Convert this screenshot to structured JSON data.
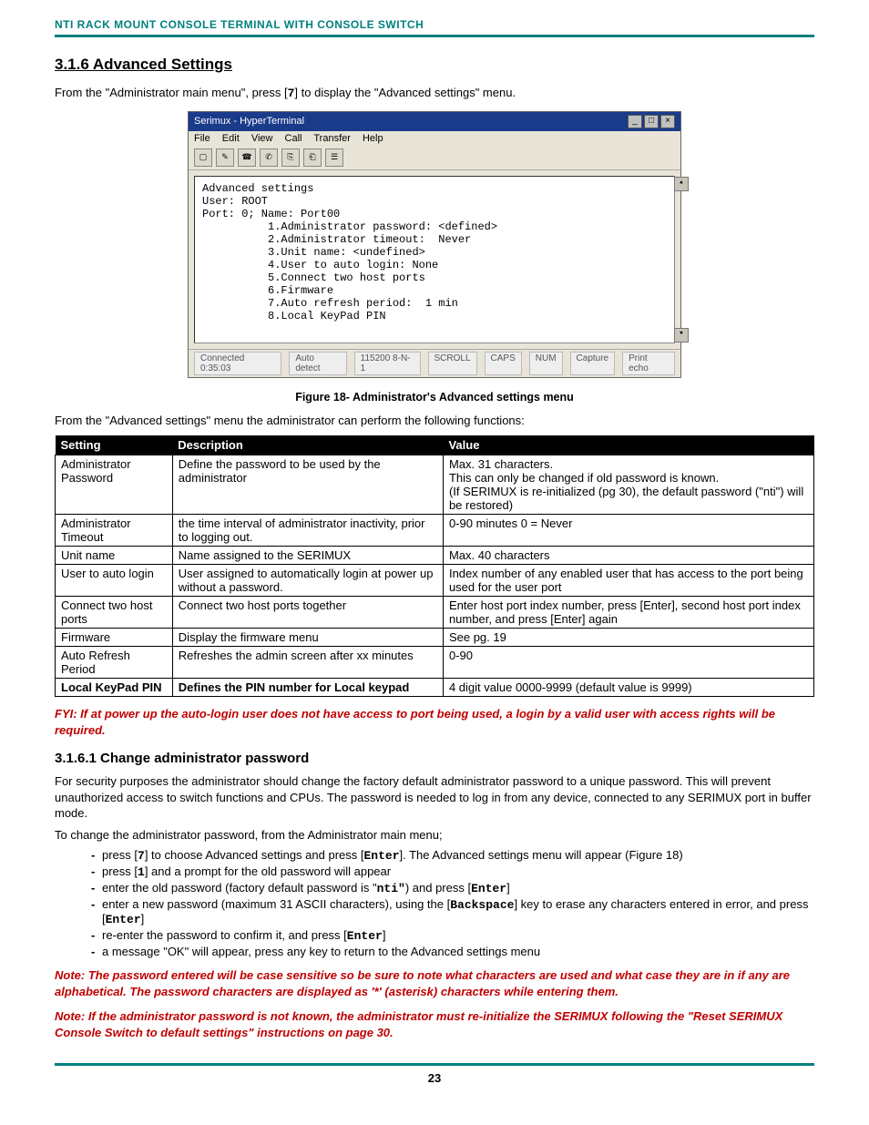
{
  "header": "NTI RACK MOUNT CONSOLE TERMINAL WITH CONSOLE SWITCH",
  "section_title": "3.1.6 Advanced Settings",
  "intro_pre": "From the \"Administrator main menu\", press [",
  "intro_key": "7",
  "intro_post": "] to display the \"Advanced settings\" menu.",
  "terminal": {
    "title": "Serimux - HyperTerminal",
    "menus": [
      "File",
      "Edit",
      "View",
      "Call",
      "Transfer",
      "Help"
    ],
    "body_lines": [
      "Advanced settings",
      "",
      "User: ROOT",
      "Port:  0; Name: Port00",
      "",
      "          1.Administrator password: <defined>",
      "          2.Administrator timeout:  Never",
      "          3.Unit name: <undefined>",
      "          4.User to auto login: None",
      "          5.Connect two host ports",
      "          6.Firmware",
      "          7.Auto refresh period:  1 min",
      "          8.Local KeyPad PIN"
    ],
    "status": [
      "Connected 0:35:03",
      "Auto detect",
      "115200 8-N-1",
      "SCROLL",
      "CAPS",
      "NUM",
      "Capture",
      "Print echo"
    ]
  },
  "figure_caption": "Figure 18- Administrator's Advanced settings menu",
  "intro2": "From the \"Advanced settings\" menu the administrator can perform the following functions:",
  "table": {
    "headers": [
      "Setting",
      "Description",
      "Value"
    ],
    "rows": [
      [
        "Administrator Password",
        "Define the password to be used by the administrator",
        "Max. 31 characters.\nThis can only be changed if old password is known.\n(If SERIMUX is re-initialized (pg 30), the default password (\"nti\") will be restored)"
      ],
      [
        "Administrator Timeout",
        "the time interval of administrator inactivity, prior to logging out.",
        "0-90 minutes   0 = Never"
      ],
      [
        "Unit name",
        "Name assigned to the SERIMUX",
        "Max. 40 characters"
      ],
      [
        "User to auto login",
        "User assigned to automatically login at power up without a password.",
        "Index number of any enabled user that has access to the port being used for the user port"
      ],
      [
        "Connect two host ports",
        "Connect two host ports together",
        "Enter host port index number, press [Enter], second host port index number, and press [Enter] again"
      ],
      [
        "Firmware",
        "Display the firmware menu",
        "See pg. 19"
      ],
      [
        "Auto Refresh Period",
        "Refreshes the admin screen after xx minutes",
        "0-90"
      ],
      [
        "Local KeyPad PIN",
        "Defines the PIN number for Local keypad",
        "4 digit value 0000-9999 (default value is 9999)"
      ]
    ]
  },
  "fyi": "FYI: If at power up the auto-login user does not have access to port being used, a login by a valid user with access rights will be required.",
  "subsection_title": "3.1.6.1 Change administrator password",
  "sub_p1": "For security purposes the administrator should change the factory default administrator password to a unique password.   This will prevent unauthorized access to switch functions and CPUs.   The password is needed to log in from any device, connected to any SERIMUX port in buffer mode.",
  "sub_p2": "To change the administrator password, from the Administrator main menu;",
  "steps": [
    {
      "pre": "press [",
      "k": "7",
      "mid": "] to choose Advanced settings and press [",
      "k2": "Enter",
      "post": "].   The Advanced settings menu will appear (Figure 18)"
    },
    {
      "pre": "press [",
      "k": "1",
      "mid": "] and a prompt for the old password will appear",
      "k2": "",
      "post": ""
    },
    {
      "pre": "enter the old password (factory default password is \"",
      "k": "nti\"",
      "mid": ") and press [",
      "k2": "Enter",
      "post": "]"
    },
    {
      "pre": "enter a new password (maximum 31 ASCII characters), using the [",
      "k": "Backspace",
      "mid": "] key to erase any characters entered in error,   and press [",
      "k2": "Enter",
      "post": "]"
    },
    {
      "pre": "re-enter the password to confirm it,  and press [",
      "k": "Enter",
      "mid": "]",
      "k2": "",
      "post": ""
    },
    {
      "pre": "a message \"OK\" will appear, press any key to return to the Advanced settings menu",
      "k": "",
      "mid": "",
      "k2": "",
      "post": ""
    }
  ],
  "note1": "Note: The password entered will be case sensitive so be sure to note what characters are used and what case they are in if any are alphabetical. The password characters are displayed as  '*' (asterisk) characters while entering them.",
  "note2": "Note:  If the administrator password is not known, the administrator must re-initialize the SERIMUX following the \"Reset SERIMUX Console Switch to default settings\" instructions on page 30.",
  "page_number": "23"
}
